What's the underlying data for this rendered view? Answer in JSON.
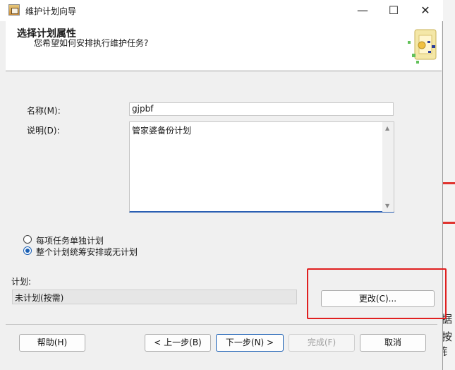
{
  "window": {
    "title": "维护计划向导"
  },
  "header": {
    "title": "选择计划属性",
    "subtitle": "您希望如何安排执行维护任务?"
  },
  "form": {
    "name_label": "名称(M):",
    "name_value": "gjpbf",
    "desc_label": "说明(D):",
    "desc_value": "管家婆备份计划"
  },
  "options": {
    "separate_label": "每项任务单独计划",
    "single_label": "整个计划统筹安排或无计划",
    "selected": "single"
  },
  "schedule": {
    "label": "计划:",
    "value": "未计划(按需)",
    "change_button": "更改(C)..."
  },
  "footer": {
    "help": "帮助(H)",
    "back": "< 上一步(B)",
    "next": "下一步(N) >",
    "finish": "完成(F)",
    "cancel": "取消"
  },
  "background_fragments": [
    "据",
    "按钅"
  ],
  "colors": {
    "highlight": "#e02020",
    "accent": "#1a5fb4"
  }
}
